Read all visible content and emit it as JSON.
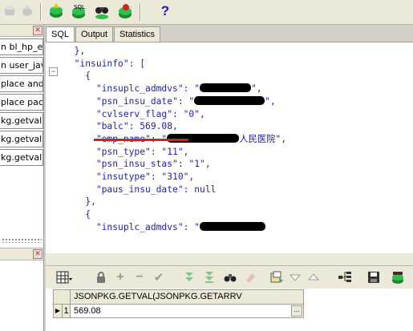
{
  "left_panel": {
    "close_glyph": "✕",
    "items": [
      "n bl_hp_ent",
      "n user_java",
      "place and c",
      "place pack",
      "kg.getval('{",
      "kg.getval(js",
      "kg.getval(js"
    ]
  },
  "tabs": [
    "SQL",
    "Output",
    "Statistics"
  ],
  "toolbar_icons": [
    "rollback-icon",
    "commit-icon",
    "sql-window-icon",
    "find-icon",
    "refresh-icon",
    "help-icon"
  ],
  "help_label": "?",
  "code": {
    "l1": "},",
    "l2": "\"insuinfo\": [",
    "l3": "{",
    "l4a": "\"insuplc_admdvs\": \"",
    "l4b": "\",",
    "l5a": "\"psn_insu_date\": \"",
    "l5b": "\",",
    "l6": "\"cvlserv_flag\": \"0\",",
    "l7": "\"balc\": 569.08,",
    "l8a": "\"emp_name\": \"",
    "l8b": "人民医院\",",
    "l9": "\"psn_type\": \"11\",",
    "l10": "\"psn_insu_stas\": \"1\",",
    "l11": "\"insutype\": \"310\",",
    "l12": "\"paus_insu_date\": null",
    "l13": "},",
    "l14": "{",
    "l15a": "\"insuplc_admdvs\": \""
  },
  "grid": {
    "column_header": "JSONPKG.GETVAL(JSONPKG.GETARRV",
    "row_indicator": "▶",
    "row_number": "1",
    "cell_value": "569.08",
    "ellipsis": "..."
  },
  "colors": {
    "code_text": "#1f1fb8",
    "highlight_underline": "#d9201b",
    "chrome": "#ece9d8"
  }
}
